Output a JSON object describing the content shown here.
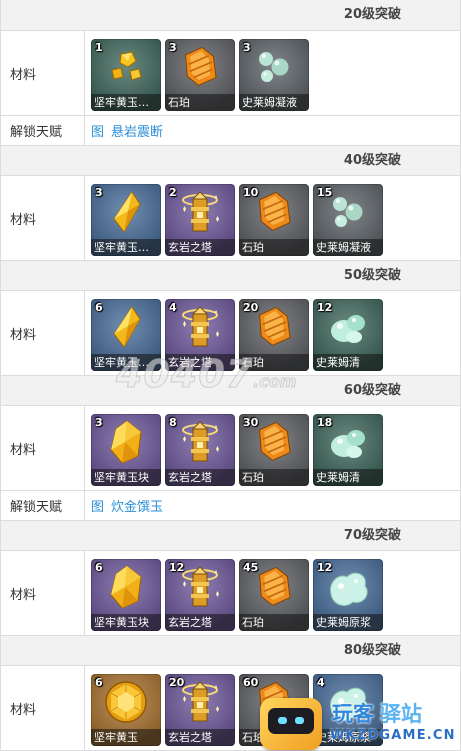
{
  "sections": [
    {
      "title": "20级突破",
      "materials_label": "材料",
      "items": [
        {
          "count": 1,
          "name": "坚牢黄玉…",
          "icon": "topaz-sliver-icon",
          "bg": "#41695e"
        },
        {
          "count": 3,
          "name": "石珀",
          "icon": "cor-lapis-icon",
          "bg": "#606266"
        },
        {
          "count": 3,
          "name": "史莱姆凝液",
          "icon": "slime-condensate-icon",
          "bg": "#5e6469"
        }
      ],
      "talent": {
        "label": "解锁天赋",
        "image_alt": "图",
        "name": "悬岩震断"
      }
    },
    {
      "title": "40级突破",
      "materials_label": "材料",
      "items": [
        {
          "count": 3,
          "name": "坚牢黄玉…",
          "icon": "topaz-fragment-icon",
          "bg": "#4a6f9b"
        },
        {
          "count": 2,
          "name": "玄岩之塔",
          "icon": "basalt-pillar-icon",
          "bg": "#6f5a9c"
        },
        {
          "count": 10,
          "name": "石珀",
          "icon": "cor-lapis-icon",
          "bg": "#606266"
        },
        {
          "count": 15,
          "name": "史莱姆凝液",
          "icon": "slime-condensate-icon",
          "bg": "#5e6469"
        }
      ]
    },
    {
      "title": "50级突破",
      "materials_label": "材料",
      "items": [
        {
          "count": 6,
          "name": "坚牢黄玉…",
          "icon": "topaz-fragment-icon",
          "bg": "#4a6f9b"
        },
        {
          "count": 4,
          "name": "玄岩之塔",
          "icon": "basalt-pillar-icon",
          "bg": "#6f5a9c"
        },
        {
          "count": 20,
          "name": "石珀",
          "icon": "cor-lapis-icon",
          "bg": "#606266"
        },
        {
          "count": 12,
          "name": "史莱姆清",
          "icon": "slime-secretions-icon",
          "bg": "#41695e"
        }
      ]
    },
    {
      "title": "60级突破",
      "materials_label": "材料",
      "items": [
        {
          "count": 3,
          "name": "坚牢黄玉块",
          "icon": "topaz-chunk-icon",
          "bg": "#6f5a9c"
        },
        {
          "count": 8,
          "name": "玄岩之塔",
          "icon": "basalt-pillar-icon",
          "bg": "#6f5a9c"
        },
        {
          "count": 30,
          "name": "石珀",
          "icon": "cor-lapis-icon",
          "bg": "#606266"
        },
        {
          "count": 18,
          "name": "史莱姆清",
          "icon": "slime-secretions-icon",
          "bg": "#41695e"
        }
      ],
      "talent": {
        "label": "解锁天赋",
        "image_alt": "图",
        "name": "炊金馔玉"
      }
    },
    {
      "title": "70级突破",
      "materials_label": "材料",
      "items": [
        {
          "count": 6,
          "name": "坚牢黄玉块",
          "icon": "topaz-chunk-icon",
          "bg": "#6f5a9c"
        },
        {
          "count": 12,
          "name": "玄岩之塔",
          "icon": "basalt-pillar-icon",
          "bg": "#6f5a9c"
        },
        {
          "count": 45,
          "name": "石珀",
          "icon": "cor-lapis-icon",
          "bg": "#606266"
        },
        {
          "count": 12,
          "name": "史莱姆原浆",
          "icon": "slime-concentrate-icon",
          "bg": "#4a6f9b"
        }
      ]
    },
    {
      "title": "80级突破",
      "materials_label": "材料",
      "items": [
        {
          "count": 6,
          "name": "坚牢黄玉",
          "icon": "topaz-gemstone-icon",
          "bg": "#ab7432"
        },
        {
          "count": 20,
          "name": "玄岩之塔",
          "icon": "basalt-pillar-icon",
          "bg": "#6f5a9c"
        },
        {
          "count": 60,
          "name": "石珀",
          "icon": "cor-lapis-icon",
          "bg": "#606266"
        },
        {
          "count": 4,
          "name": "史莱姆原浆",
          "icon": "slime-concentrate-icon",
          "bg": "#4a6f9b"
        }
      ]
    }
  ],
  "watermark": {
    "main": "40407",
    "suffix": ".com"
  },
  "logo": {
    "icon": "robot-logo-icon",
    "title_a": "玩客",
    "title_b": "驿站",
    "domain": "WKZDGAME.CN"
  },
  "colors": {
    "border": "#dcdcdc",
    "header_bg": "#f2f2f2",
    "link": "#2a8fd8"
  }
}
